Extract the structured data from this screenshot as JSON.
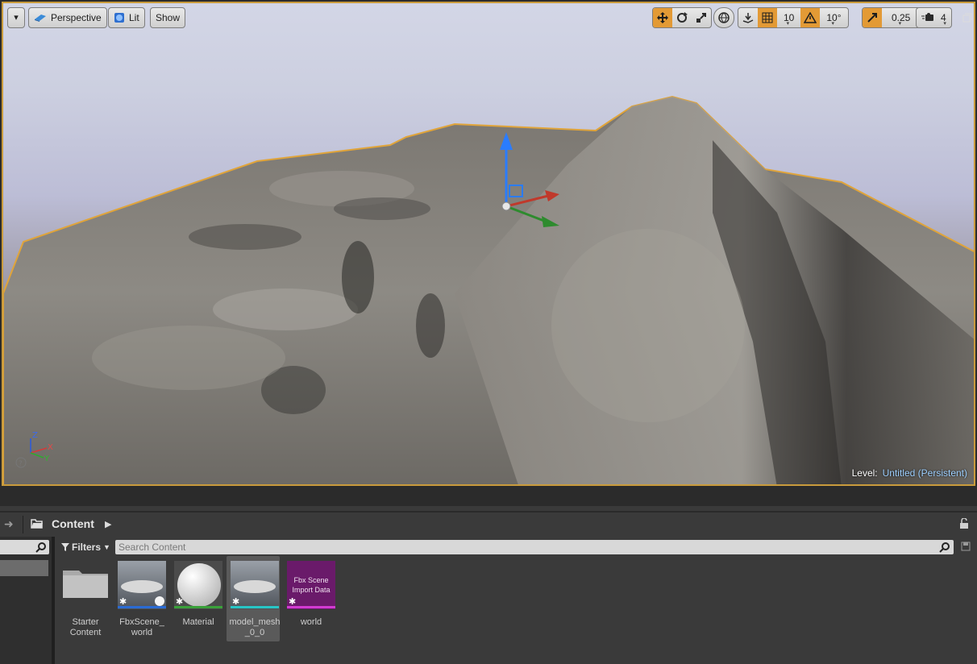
{
  "viewport": {
    "menu_caret": "▾",
    "perspective_label": "Perspective",
    "lit_label": "Lit",
    "show_label": "Show",
    "grid_snap_value": "10",
    "rotation_snap_value": "10°",
    "scale_snap_value": "0.25",
    "camera_speed_value": "4",
    "level_prefix": "Level:",
    "level_name": "Untitled (Persistent)",
    "axis_labels": {
      "z": "Z",
      "x": "X",
      "y": "Y"
    },
    "help_glyph": "?",
    "icons": [
      "menu-caret-icon",
      "perspective-cube-icon",
      "lit-sphere-icon",
      "translate-icon",
      "rotate-icon",
      "scale-icon",
      "world-local-icon",
      "surface-snap-icon",
      "grid-snap-icon",
      "rotation-snap-icon",
      "scale-snap-icon",
      "camera-speed-icon",
      "maximize-icon"
    ],
    "colors": {
      "selection_outline": "#c99b3c",
      "active_toggle": "#e39a35",
      "gizmo_z": "#2a7cff",
      "gizmo_x": "#c0392b",
      "gizmo_y": "#2e8b2e"
    }
  },
  "content_browser": {
    "nav_arrow": "➜",
    "breadcrumb": "Content",
    "breadcrumb_arrow": "▶",
    "filters_label": "Filters",
    "search_placeholder": "Search Content",
    "assets": [
      {
        "label": "Starter Content",
        "type": "folder"
      },
      {
        "label": "FbxScene_ world",
        "type": "static-mesh",
        "strip_color": "#2a6bd4"
      },
      {
        "label": "Material",
        "type": "material",
        "strip_color": "#3aa13a"
      },
      {
        "label": "model_mesh _0_0",
        "type": "static-mesh",
        "strip_color": "#27c6c6",
        "selected": true
      },
      {
        "label": "world",
        "type": "fbx-scene-import-data",
        "strip_color": "#d23bd2",
        "thumb_text": "Fbx Scene Import Data"
      }
    ]
  }
}
